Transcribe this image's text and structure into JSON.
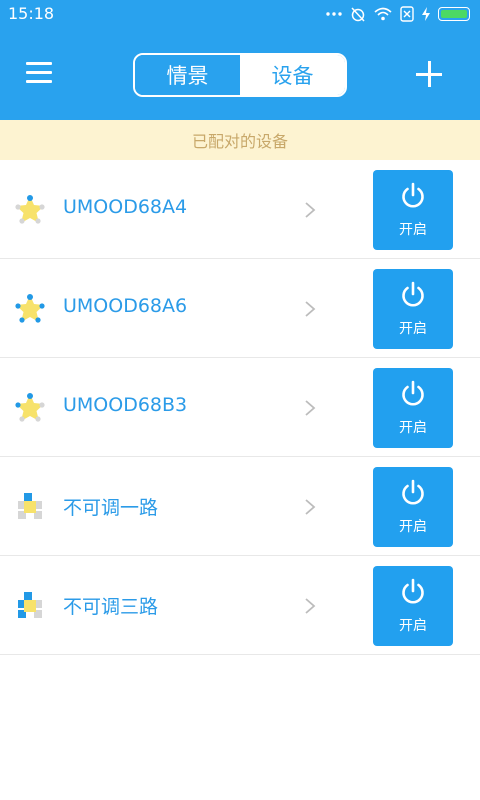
{
  "status_bar": {
    "time": "15:18"
  },
  "app_bar": {
    "tabs": [
      {
        "label": "情景",
        "active": false
      },
      {
        "label": "设备",
        "active": true
      }
    ]
  },
  "section_header": "已配对的设备",
  "devices": [
    {
      "name": "UMOOD68A4",
      "icon": "star-light-icon",
      "button_label": "开启"
    },
    {
      "name": "UMOOD68A6",
      "icon": "star-light-icon",
      "button_label": "开启"
    },
    {
      "name": "UMOOD68B3",
      "icon": "star-light-icon",
      "button_label": "开启"
    },
    {
      "name": "不可调一路",
      "icon": "switch-light-icon",
      "button_label": "开启"
    },
    {
      "name": "不可调三路",
      "icon": "switch-light-icon",
      "button_label": "开启"
    }
  ],
  "colors": {
    "primary": "#29a2ee",
    "button": "#22a0ef",
    "header_bg": "#fdf3d1",
    "header_text": "#c8a86a",
    "device_name": "#2b9be8",
    "icon_yellow": "#f7e26b"
  }
}
